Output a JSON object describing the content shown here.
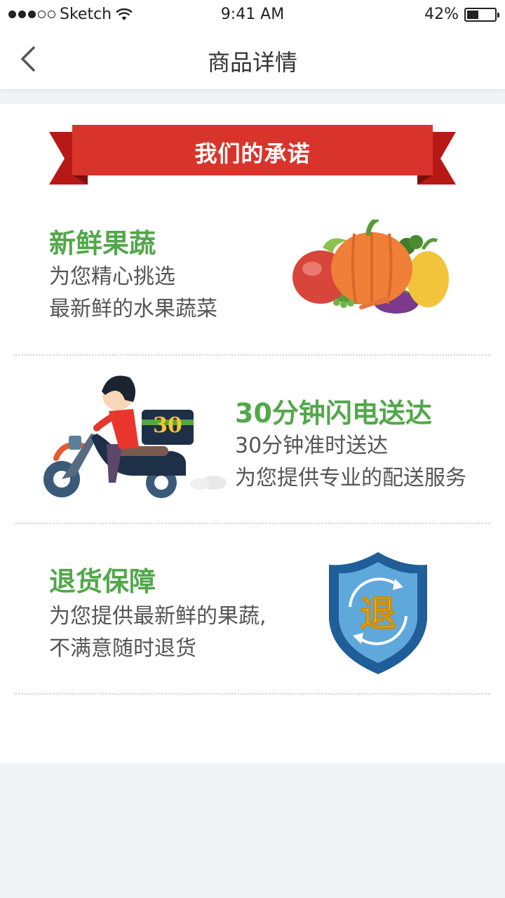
{
  "status": {
    "carrier": "Sketch",
    "time": "9:41 AM",
    "battery": "42%",
    "battery_level": 0.42
  },
  "nav": {
    "title": "商品详情"
  },
  "banner": {
    "title": "我们的承诺"
  },
  "sections": [
    {
      "title": "新鲜果蔬",
      "lines": [
        "为您精心挑选",
        "最新鲜的水果蔬菜"
      ],
      "icon": "vegetables-icon"
    },
    {
      "title": "30分钟闪电送达",
      "lines": [
        "30分钟准时送达",
        "为您提供专业的配送服务"
      ],
      "icon": "scooter-delivery-icon",
      "badge": "30"
    },
    {
      "title": "退货保障",
      "lines": [
        "为您提供最新鲜的果蔬,",
        "不满意随时退货"
      ],
      "icon": "return-shield-icon",
      "badge": "退"
    }
  ],
  "colors": {
    "green": "#52a74a",
    "red": "#d9342b",
    "blue": "#2d6fb4"
  }
}
